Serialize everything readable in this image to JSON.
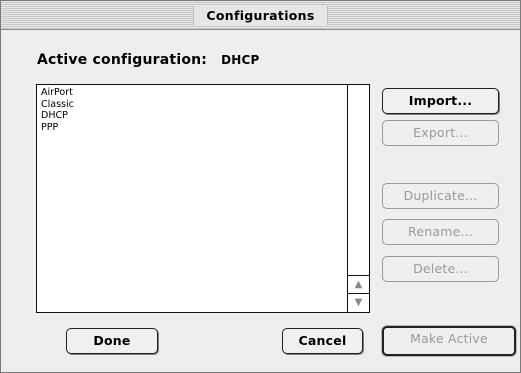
{
  "window": {
    "title": "Configurations"
  },
  "active": {
    "label": "Active configuration:",
    "value": "DHCP"
  },
  "list": {
    "items": [
      "AirPort",
      "Classic",
      "DHCP",
      "PPP"
    ]
  },
  "scrollbar": {
    "up_glyph": "▲",
    "down_glyph": "▼"
  },
  "buttons": {
    "import": "Import...",
    "export": "Export...",
    "duplicate": "Duplicate...",
    "rename": "Rename...",
    "delete": "Delete...",
    "done": "Done",
    "cancel": "Cancel",
    "make_active": "Make Active"
  }
}
